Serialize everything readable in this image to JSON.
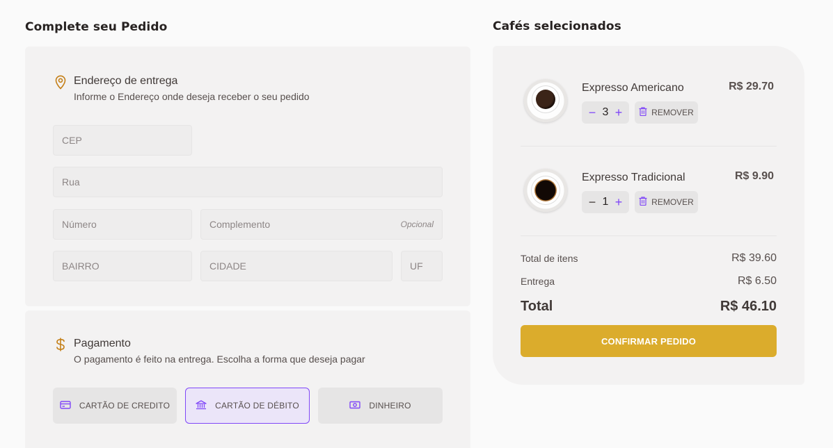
{
  "left": {
    "heading": "Complete seu Pedido",
    "address": {
      "title": "Endereço de entrega",
      "subtitle": "Informe o Endereço onde deseja receber o seu pedido",
      "icon": "map-pin-icon",
      "fields": {
        "cep": "CEP",
        "rua": "Rua",
        "numero": "Número",
        "complemento": "Complemento",
        "complemento_hint": "Opcional",
        "bairro": "BAIRRO",
        "cidade": "CIDADE",
        "uf": "UF"
      }
    },
    "payment": {
      "title": "Pagamento",
      "subtitle": "O pagamento é feito na entrega. Escolha a forma que deseja pagar",
      "icon": "currency-dollar-icon",
      "options": [
        {
          "label": "CARTÃO DE CREDITO",
          "icon": "credit-card-icon",
          "selected": false
        },
        {
          "label": "CARTÃO DE DÉBITO",
          "icon": "bank-icon",
          "selected": true
        },
        {
          "label": "DINHEIRO",
          "icon": "money-icon",
          "selected": false
        }
      ]
    }
  },
  "cart": {
    "heading": "Cafés selecionados",
    "items": [
      {
        "name": "Expresso Americano",
        "price": "R$ 29.70",
        "qty": "3",
        "remove_label": "REMOVER"
      },
      {
        "name": "Expresso Tradicional",
        "price": "R$ 9.90",
        "qty": "1",
        "remove_label": "REMOVER"
      }
    ],
    "summary": {
      "items_label": "Total de itens",
      "items_value": "R$ 39.60",
      "delivery_label": "Entrega",
      "delivery_value": "R$ 6.50",
      "total_label": "Total",
      "total_value": "R$ 46.10"
    },
    "confirm_label": "CONFIRMAR PEDIDO"
  },
  "colors": {
    "accent_purple": "#8047f8",
    "accent_yellow": "#dbac2c",
    "yellow_dark": "#c47f17",
    "card_bg": "#f3f2f2"
  }
}
